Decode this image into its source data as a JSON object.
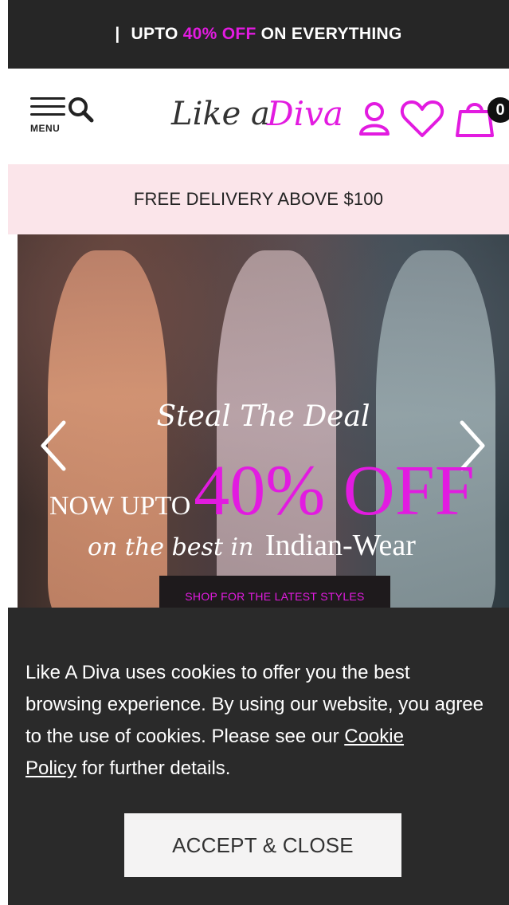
{
  "announcement": {
    "separator": "|",
    "prefix": "UPTO",
    "highlight": "40% OFF",
    "suffix": "ON EVERYTHING"
  },
  "header": {
    "menu_label": "MENU",
    "logo_like": "Like a",
    "logo_diva": "Diva",
    "cart_count": "0",
    "icons": [
      "hamburger-icon",
      "search-icon",
      "user-icon",
      "heart-icon",
      "shopping-bag-icon"
    ]
  },
  "delivery_banner": "FREE DELIVERY ABOVE $100",
  "hero": {
    "tagline": "Steal The Deal",
    "now_upto": "NOW UPTO",
    "discount": "40% OFF",
    "best_in": "on the best in",
    "category": "Indian-Wear",
    "cta": "SHOP FOR THE LATEST STYLES"
  },
  "cookie": {
    "text_before": "Like A Diva uses cookies to offer you the best browsing experience. By using our website, you agree to the use of cookies. Please see our ",
    "link_cookie": "Cookie",
    "link_policy": "Policy",
    "text_after": " for further details.",
    "accept_label": "ACCEPT & CLOSE"
  },
  "colors": {
    "accent": "#e21be0",
    "dark": "#262626",
    "delivery_bg": "#fbe5ea",
    "cookie_bg": "#2a2a2a"
  }
}
